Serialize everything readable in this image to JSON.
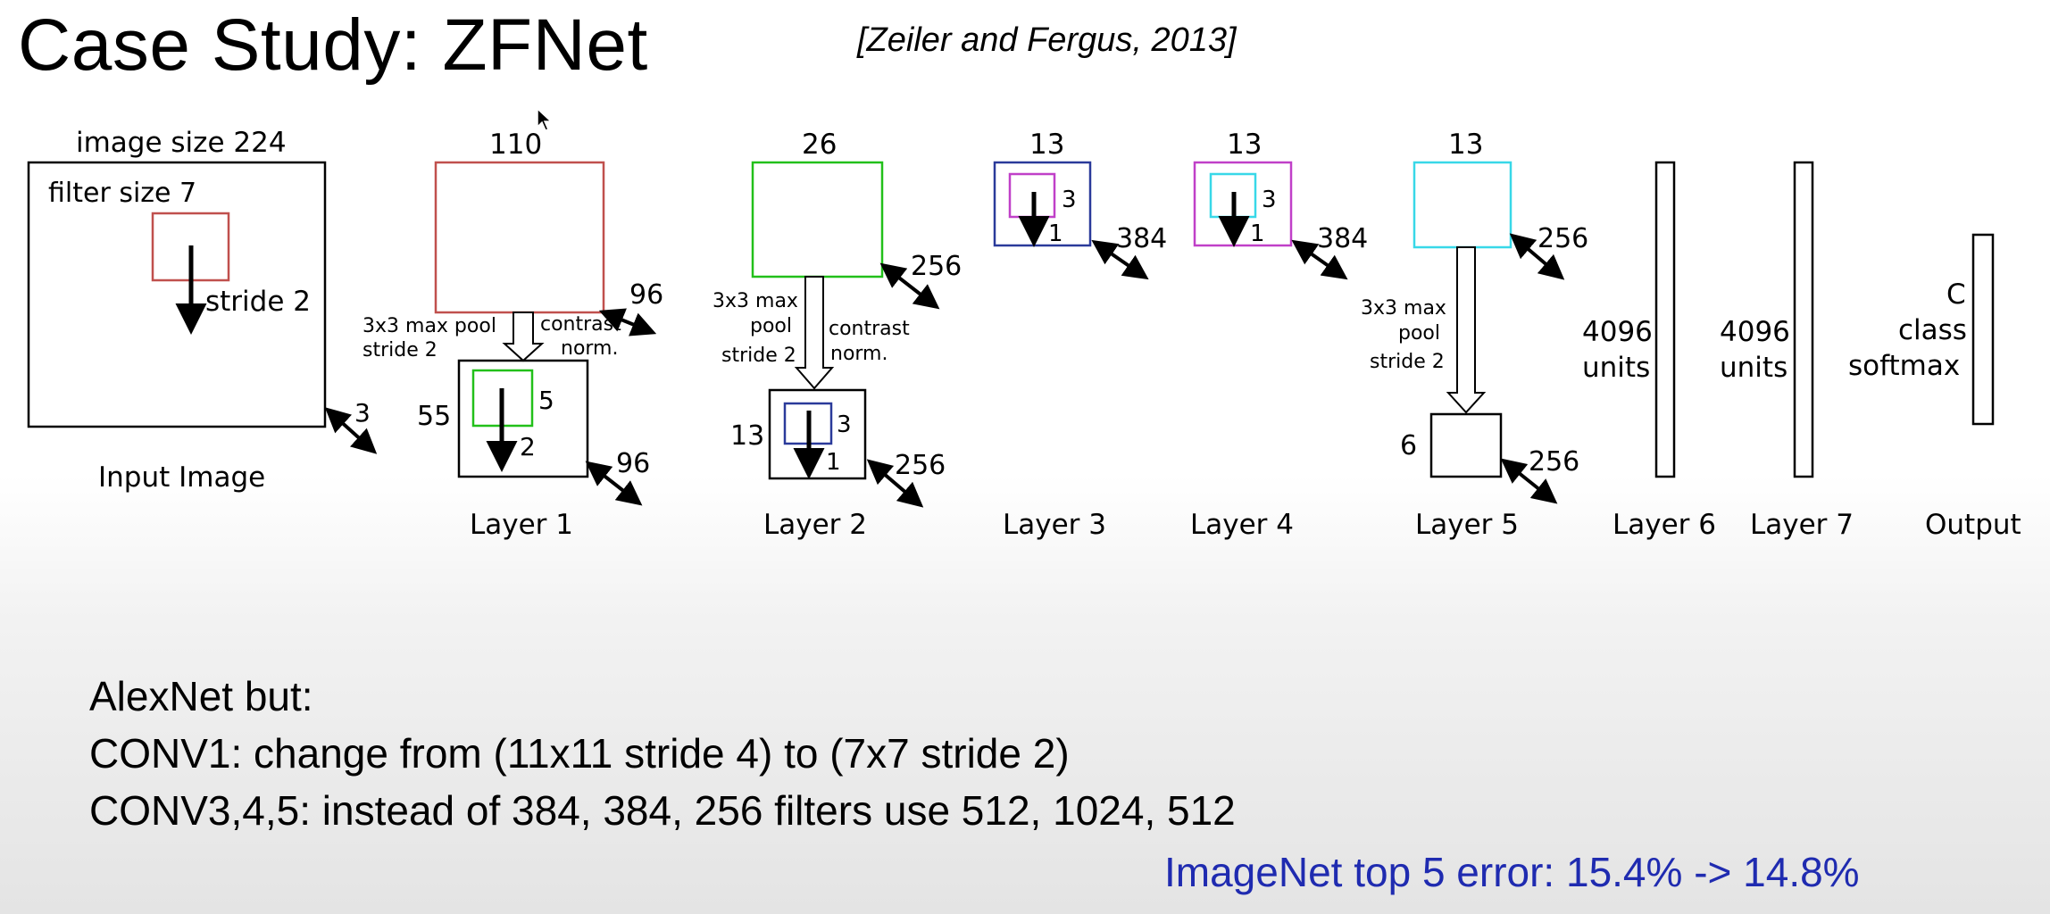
{
  "slide": {
    "title": "Case Study: ZFNet",
    "citation": "[Zeiler and Fergus, 2013]"
  },
  "diagram": {
    "input": {
      "image_size": "image size 224",
      "filter_size": "filter size 7",
      "stride": "stride 2",
      "depth": "3",
      "caption": "Input Image",
      "filter_color": "#c0504d"
    },
    "layer1": {
      "size": "110",
      "depth": "96",
      "pool_l1": "3x3 max pool",
      "pool_l2": "stride 2",
      "contrast_l1": "contrast",
      "contrast_l2": "norm.",
      "out_size": "55",
      "filter": "5",
      "stride": "2",
      "out_depth": "96",
      "caption": "Layer 1",
      "color": "#c0504d"
    },
    "layer2": {
      "size": "26",
      "depth": "256",
      "pool_l1": "3x3 max",
      "pool_l2": "pool",
      "pool_l3": "stride 2",
      "contrast_l1": "contrast",
      "contrast_l2": "norm.",
      "out_size": "13",
      "filter": "3",
      "stride": "1",
      "out_depth": "256",
      "caption": "Layer 2",
      "color": "#22c01a"
    },
    "layer3": {
      "size": "13",
      "filter": "3",
      "stride": "1",
      "depth": "384",
      "caption": "Layer 3",
      "color": "#2a3a9a"
    },
    "layer4": {
      "size": "13",
      "filter": "3",
      "stride": "1",
      "depth": "384",
      "caption": "Layer 4",
      "color": "#c040c8"
    },
    "layer5": {
      "size": "13",
      "depth": "256",
      "pool_l1": "3x3 max",
      "pool_l2": "pool",
      "pool_l3": "stride 2",
      "out_size": "6",
      "out_depth": "256",
      "caption": "Layer 5",
      "color": "#38d8e8"
    },
    "layer6": {
      "units_l1": "4096",
      "units_l2": "units",
      "caption": "Layer 6"
    },
    "layer7": {
      "units_l1": "4096",
      "units_l2": "units",
      "caption": "Layer 7"
    },
    "output": {
      "l1": "C",
      "l2": "class",
      "l3": "softmax",
      "caption": "Output"
    }
  },
  "notes": {
    "line1": "AlexNet but:",
    "line2": "CONV1: change from (11x11 stride 4) to (7x7 stride 2)",
    "line3": "CONV3,4,5: instead of 384, 384, 256 filters use 512, 1024, 512"
  },
  "result": "ImageNet top 5 error: 15.4% -> 14.8%",
  "icons": {
    "cursor": "mouse-cursor-icon"
  }
}
